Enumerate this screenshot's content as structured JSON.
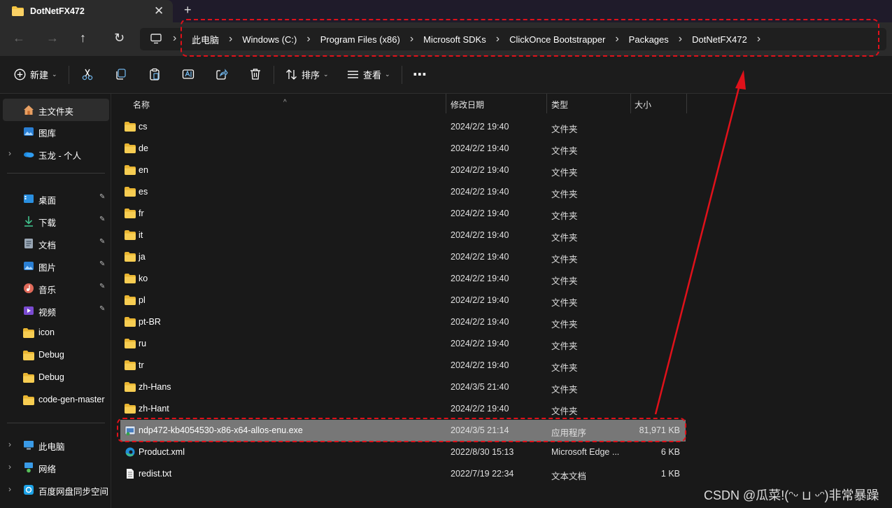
{
  "window": {
    "tab_title": "DotNetFX472",
    "tab_close": "✕",
    "new_tab": "+"
  },
  "nav": {
    "back": "←",
    "forward": "→",
    "up": "↑",
    "refresh": "↻"
  },
  "breadcrumb": {
    "sep": "›",
    "items": [
      "此电脑",
      "Windows (C:)",
      "Program Files (x86)",
      "Microsoft SDKs",
      "ClickOnce Bootstrapper",
      "Packages",
      "DotNetFX472"
    ]
  },
  "toolbar": {
    "new_label": "新建",
    "sort_label": "排序",
    "view_label": "查看",
    "more": "⋯",
    "dropdown": "⌄"
  },
  "sidebar": {
    "items": [
      {
        "label": "主文件夹",
        "icon": "home-icon"
      },
      {
        "label": "图库",
        "icon": "gallery-icon"
      },
      {
        "label": "玉龙 - 个人",
        "icon": "onedrive-icon"
      },
      {
        "label": "桌面",
        "icon": "desktop-icon"
      },
      {
        "label": "下载",
        "icon": "download-icon"
      },
      {
        "label": "文档",
        "icon": "document-icon"
      },
      {
        "label": "图片",
        "icon": "pictures-icon"
      },
      {
        "label": "音乐",
        "icon": "music-icon"
      },
      {
        "label": "视频",
        "icon": "video-icon"
      },
      {
        "label": "icon",
        "icon": "folder-icon"
      },
      {
        "label": "Debug",
        "icon": "folder-icon"
      },
      {
        "label": "Debug",
        "icon": "folder-icon"
      },
      {
        "label": "code-gen-master",
        "icon": "folder-icon"
      },
      {
        "label": "此电脑",
        "icon": "computer-icon"
      },
      {
        "label": "网络",
        "icon": "network-icon"
      },
      {
        "label": "百度网盘同步空间",
        "icon": "baidu-netdisk-icon"
      }
    ],
    "chevron": "›",
    "pin": "📌"
  },
  "columns": {
    "name": "名称",
    "date": "修改日期",
    "type": "类型",
    "size": "大小",
    "sort_indicator": "^"
  },
  "files": [
    {
      "name": "cs",
      "date": "2024/2/2 19:40",
      "type": "文件夹",
      "size": "",
      "icon": "folder-icon"
    },
    {
      "name": "de",
      "date": "2024/2/2 19:40",
      "type": "文件夹",
      "size": "",
      "icon": "folder-icon"
    },
    {
      "name": "en",
      "date": "2024/2/2 19:40",
      "type": "文件夹",
      "size": "",
      "icon": "folder-icon"
    },
    {
      "name": "es",
      "date": "2024/2/2 19:40",
      "type": "文件夹",
      "size": "",
      "icon": "folder-icon"
    },
    {
      "name": "fr",
      "date": "2024/2/2 19:40",
      "type": "文件夹",
      "size": "",
      "icon": "folder-icon"
    },
    {
      "name": "it",
      "date": "2024/2/2 19:40",
      "type": "文件夹",
      "size": "",
      "icon": "folder-icon"
    },
    {
      "name": "ja",
      "date": "2024/2/2 19:40",
      "type": "文件夹",
      "size": "",
      "icon": "folder-icon"
    },
    {
      "name": "ko",
      "date": "2024/2/2 19:40",
      "type": "文件夹",
      "size": "",
      "icon": "folder-icon"
    },
    {
      "name": "pl",
      "date": "2024/2/2 19:40",
      "type": "文件夹",
      "size": "",
      "icon": "folder-icon"
    },
    {
      "name": "pt-BR",
      "date": "2024/2/2 19:40",
      "type": "文件夹",
      "size": "",
      "icon": "folder-icon"
    },
    {
      "name": "ru",
      "date": "2024/2/2 19:40",
      "type": "文件夹",
      "size": "",
      "icon": "folder-icon"
    },
    {
      "name": "tr",
      "date": "2024/2/2 19:40",
      "type": "文件夹",
      "size": "",
      "icon": "folder-icon"
    },
    {
      "name": "zh-Hans",
      "date": "2024/3/5 21:40",
      "type": "文件夹",
      "size": "",
      "icon": "folder-icon"
    },
    {
      "name": "zh-Hant",
      "date": "2024/2/2 19:40",
      "type": "文件夹",
      "size": "",
      "icon": "folder-icon"
    },
    {
      "name": "ndp472-kb4054530-x86-x64-allos-enu.exe",
      "date": "2024/3/5 21:14",
      "type": "应用程序",
      "size": "81,971 KB",
      "icon": "installer-icon"
    },
    {
      "name": "Product.xml",
      "date": "2022/8/30 15:13",
      "type": "Microsoft Edge ...",
      "size": "6 KB",
      "icon": "edge-icon"
    },
    {
      "name": "redist.txt",
      "date": "2022/7/19 22:34",
      "type": "文本文档",
      "size": "1 KB",
      "icon": "text-file-icon"
    }
  ],
  "watermark": "CSDN @瓜菜!(ᵔᵕ ⊔ ᵕᵔ)非常暴躁",
  "colors": {
    "annotation": "#e0111a",
    "folder": "#f5c542",
    "selected_row": "#777777"
  }
}
